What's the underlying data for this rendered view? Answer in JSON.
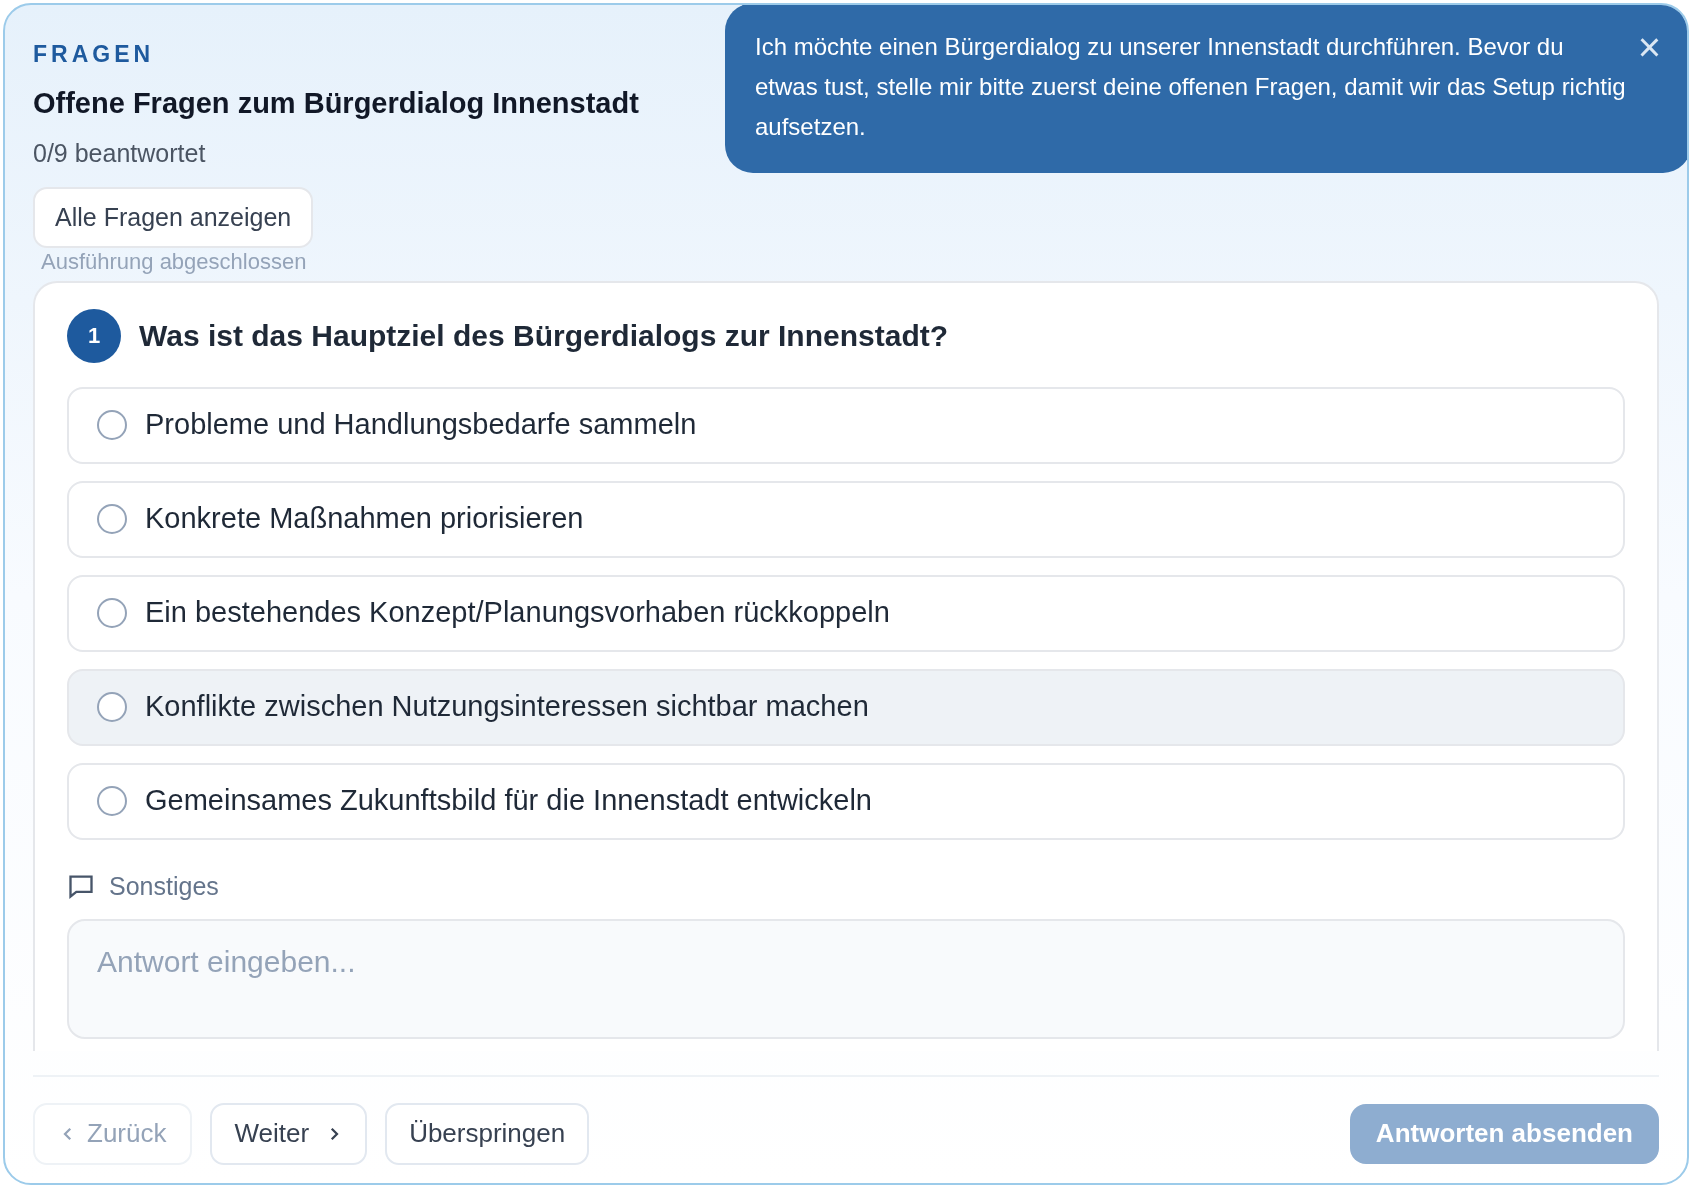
{
  "panel": {
    "eyebrow": "FRAGEN",
    "title": "Offene Fragen zum Bürgerdialog Innenstadt",
    "progress": "0/9 beantwortet",
    "show_all_button": "Alle Fragen anzeigen",
    "faded_status": "Ausführung abgeschlossen"
  },
  "message_bubble": {
    "text": "Ich möchte einen Bürgerdialog zu unserer Innenstadt durchführen. Bevor du etwas tust, stelle mir bitte zuerst deine offenen Fragen, damit wir das Setup richtig aufsetzen.",
    "close": "×"
  },
  "question": {
    "number": "1",
    "text": "Was ist das Hauptziel des Bürgerdialogs zur Innenstadt?",
    "options": [
      {
        "label": "Probleme und Handlungsbedarfe sammeln",
        "selected": false,
        "hovered": false
      },
      {
        "label": "Konkrete Maßnahmen priorisieren",
        "selected": false,
        "hovered": false
      },
      {
        "label": "Ein bestehendes Konzept/Planungsvorhaben rückkoppeln",
        "selected": false,
        "hovered": false
      },
      {
        "label": "Konflikte zwischen Nutzungsinteressen sichtbar machen",
        "selected": false,
        "hovered": true
      },
      {
        "label": "Gemeinsames Zukunftsbild für die Innenstadt entwickeln",
        "selected": false,
        "hovered": false
      }
    ],
    "other_label": "Sonstiges",
    "other_placeholder": "Antwort eingeben..."
  },
  "footer": {
    "back": {
      "label": "Zurück",
      "disabled": true
    },
    "next": {
      "label": "Weiter",
      "disabled": false
    },
    "skip": {
      "label": "Überspringen",
      "disabled": false
    },
    "submit": {
      "label": "Antworten absenden",
      "disabled": true
    }
  }
}
